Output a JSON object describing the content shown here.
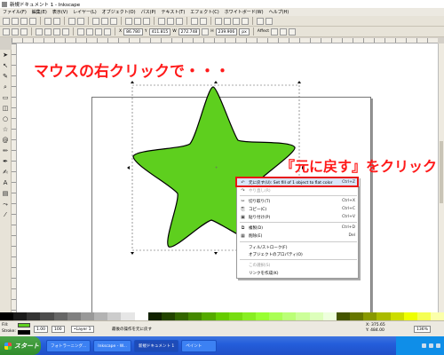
{
  "window": {
    "title": "新規ドキュメント 1 - Inkscape"
  },
  "menubar": {
    "items": [
      "ファイル(F)",
      "編集(E)",
      "表示(V)",
      "レイヤー(L)",
      "オブジェクト(O)",
      "パス(P)",
      "テキスト(T)",
      "エフェクト(C)",
      "ホワイトボード(W)",
      "ヘルプ(H)"
    ]
  },
  "toolbar2": {
    "x_label": "X",
    "x_value": "86.780",
    "y_label": "Y",
    "y_value": "411.815",
    "w_label": "W",
    "w_value": "272.748",
    "h_label": "H",
    "h_value": "239.906",
    "unit": "px",
    "affect_label": "Affect"
  },
  "annotations": {
    "mouse": "マウスの右クリックで・・・",
    "revert": "『元に戻す』をクリック"
  },
  "context_menu": {
    "items": [
      {
        "label": "元に戻す(U): Set fill of 1 object to flat color",
        "shortcut": "Ctrl+Z",
        "icon": "undo-icon",
        "enabled": true
      },
      {
        "label": "やり直し(R)",
        "shortcut": "",
        "icon": "redo-icon",
        "enabled": false
      },
      {
        "label": "切り取り(T)",
        "shortcut": "Ctrl+X",
        "icon": "cut-icon",
        "enabled": true
      },
      {
        "label": "コピー(C)",
        "shortcut": "Ctrl+C",
        "icon": "copy-icon",
        "enabled": true
      },
      {
        "label": "貼り付け(P)",
        "shortcut": "Ctrl+V",
        "icon": "paste-icon",
        "enabled": true
      },
      {
        "label": "複製(D)",
        "shortcut": "Ctrl+D",
        "icon": "duplicate-icon",
        "enabled": true
      },
      {
        "label": "削除(E)",
        "shortcut": "Del",
        "icon": "delete-icon",
        "enabled": true
      },
      {
        "label": "フィル/ストローク(F)",
        "shortcut": "",
        "icon": "",
        "enabled": true
      },
      {
        "label": "オブジェクトのプロパティ(O)",
        "shortcut": "",
        "icon": "",
        "enabled": true
      },
      {
        "label": "この選択(S)",
        "shortcut": "",
        "icon": "",
        "enabled": false
      },
      {
        "label": "リンクを作成(K)",
        "shortcut": "",
        "icon": "",
        "enabled": true
      }
    ]
  },
  "statusbar": {
    "fill_label": "Fill:",
    "stroke_label": "Stroke:",
    "stroke_width": "1.00",
    "opacity": "100",
    "layer": "•Layer 1",
    "message": "最後の操作を元に戻す",
    "x_coord": "X: 375.65",
    "y_coord": "Y: 484.00",
    "zoom": "136%"
  },
  "taskbar": {
    "start": "スタート",
    "tasks": [
      "フォトラーニング...",
      "Inkscape - W...",
      "新規ドキュメント 1",
      "ペイント"
    ]
  },
  "colors": {
    "star_fill": "#5ecf1e",
    "annotation": "#ff1a1a",
    "highlight_border": "#e81414"
  }
}
